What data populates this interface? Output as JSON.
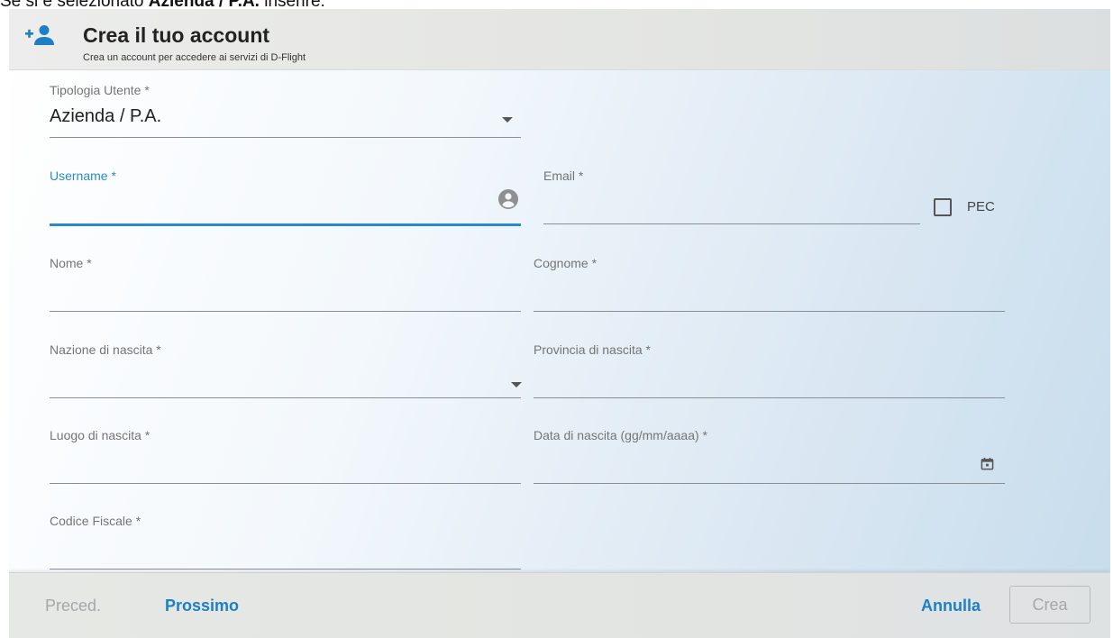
{
  "caption": {
    "prefix": "Se si è selezionato ",
    "emphasis": "Azienda / P.A.",
    "suffix": " inserire:"
  },
  "header": {
    "title": "Crea il tuo account",
    "subtitle": "Crea un account per accedere ai servizi di D-Flight",
    "icon": "add-user-icon"
  },
  "form": {
    "tipologia": {
      "label": "Tipologia Utente *",
      "value": "Azienda / P.A."
    },
    "username": {
      "label": "Username *",
      "value": "",
      "icon": "account-circle-icon"
    },
    "email": {
      "label": "Email *",
      "value": ""
    },
    "pec": {
      "label": "PEC",
      "checked": false
    },
    "nome": {
      "label": "Nome *",
      "value": ""
    },
    "cognome": {
      "label": "Cognome *",
      "value": ""
    },
    "nazione": {
      "label": "Nazione di nascita *",
      "value": ""
    },
    "provincia": {
      "label": "Provincia di nascita *",
      "value": ""
    },
    "luogo": {
      "label": "Luogo di nascita *",
      "value": ""
    },
    "data_nascita": {
      "label": "Data di nascita (gg/mm/aaaa) *",
      "value": "",
      "icon": "calendar-icon"
    },
    "codice_fiscale": {
      "label": "Codice Fiscale *",
      "value": ""
    }
  },
  "footer": {
    "prev": "Preced.",
    "next": "Prossimo",
    "cancel": "Annulla",
    "create": "Crea"
  },
  "colors": {
    "accent": "#2a8ac9",
    "primary_button": "#1d7fc4",
    "disabled": "#a5a8a9"
  }
}
